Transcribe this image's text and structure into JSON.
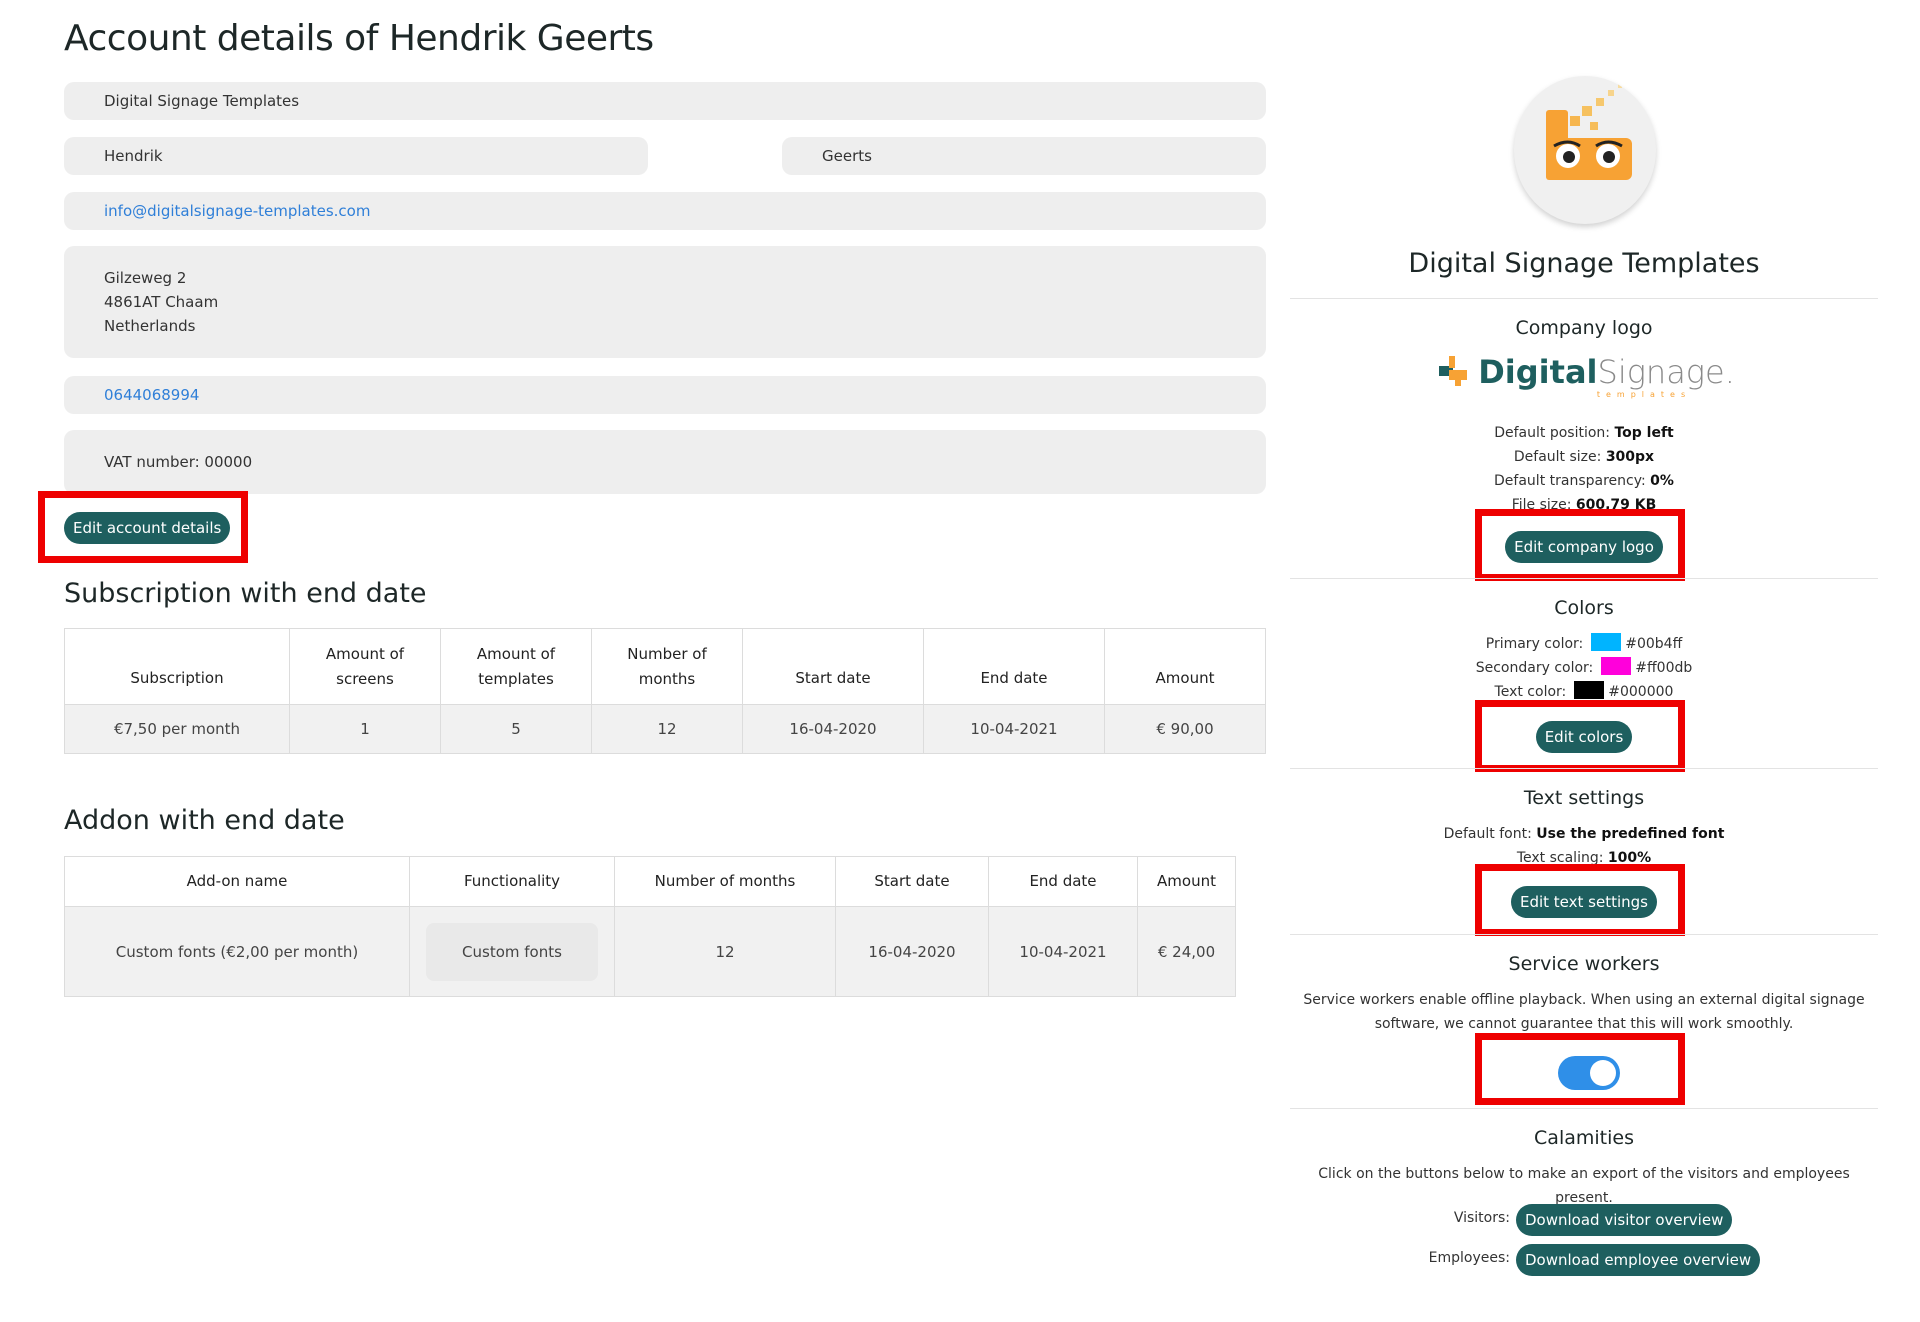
{
  "page": {
    "title": "Account details of  Hendrik Geerts"
  },
  "account": {
    "company": "Digital Signage Templates",
    "first_name": "Hendrik",
    "last_name": "Geerts",
    "email": "info@digitalsignage-templates.com",
    "address": [
      "Gilzeweg 2",
      "4861AT Chaam",
      "Netherlands"
    ],
    "phone": "0644068994",
    "vat": "VAT number: 00000",
    "edit_button": "Edit account details"
  },
  "subscription": {
    "title": "Subscription with end date",
    "headers": [
      "Subscription",
      "Amount of screens",
      "Amount of templates",
      "Number of months",
      "Start date",
      "End date",
      "Amount"
    ],
    "headers_lines": [
      [
        "Subscription"
      ],
      [
        "Amount of",
        "screens"
      ],
      [
        "Amount of",
        "templates"
      ],
      [
        "Number of",
        "months"
      ],
      [
        "Start date"
      ],
      [
        "End date"
      ],
      [
        "Amount"
      ]
    ],
    "rows": [
      [
        "€7,50 per month",
        "1",
        "5",
        "12",
        "16-04-2020",
        "10-04-2021",
        "€ 90,00"
      ]
    ]
  },
  "addon": {
    "title": "Addon with end date",
    "headers": [
      "Add-on name",
      "Functionality",
      "Number of months",
      "Start date",
      "End date",
      "Amount"
    ],
    "rows": [
      [
        "Custom fonts (€2,00 per month)",
        "Custom fonts",
        "12",
        "16-04-2020",
        "10-04-2021",
        "€ 24,00"
      ]
    ]
  },
  "profile": {
    "name": "Digital Signage Templates"
  },
  "company_logo": {
    "heading": "Company logo",
    "logo_text_bold": "Digital",
    "logo_text_light": "Signage.",
    "logo_subtext": "templates",
    "position_label": "Default position:",
    "position_value": "Top left",
    "size_label": "Default size:",
    "size_value": "300px",
    "transparency_label": "Default transparency:",
    "transparency_value": "0%",
    "filesize_label": "File size:",
    "filesize_value": "600,79  KB",
    "edit_button": "Edit company logo"
  },
  "colors": {
    "heading": "Colors",
    "primary_label": "Primary color:",
    "primary_value": "#00b4ff",
    "secondary_label": "Secondary color:",
    "secondary_value": "#ff00db",
    "text_label": "Text color:",
    "text_value": "#000000",
    "edit_button": "Edit colors"
  },
  "text_settings": {
    "heading": "Text settings",
    "font_label": "Default font:",
    "font_value": "Use the predefined font",
    "scaling_label": "Text scaling:",
    "scaling_value": "100%",
    "edit_button": "Edit text settings"
  },
  "service_workers": {
    "heading": "Service workers",
    "description_line1": "Service workers enable offline playback. When using an external digital signage",
    "description_line2": "software, we cannot guarantee that this will work smoothly.",
    "enabled": true
  },
  "calamities": {
    "heading": "Calamities",
    "description": "Click on the buttons below to make an export of the visitors and employees present.",
    "visitors_label": "Visitors:",
    "visitors_button": "Download visitor overview",
    "employees_label": "Employees:",
    "employees_button": "Download employee overview"
  },
  "colors_theme": {
    "button_bg": "#1e5f5f",
    "highlight": "#ee0000",
    "toggle_on": "#2f8fe8",
    "link": "#2f7fd8"
  }
}
